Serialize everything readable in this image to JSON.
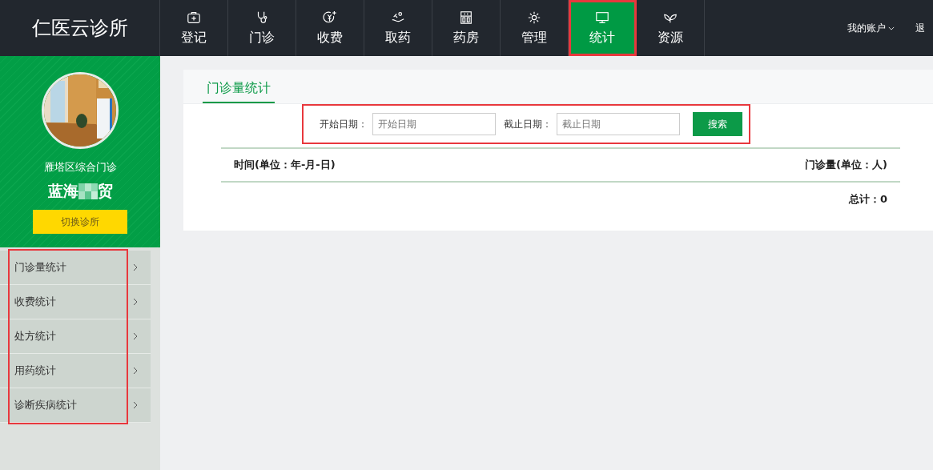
{
  "brand": "仁医云诊所",
  "nav": [
    {
      "label": "登记",
      "selected": false
    },
    {
      "label": "门诊",
      "selected": false
    },
    {
      "label": "收费",
      "selected": false
    },
    {
      "label": "取药",
      "selected": false
    },
    {
      "label": "药房",
      "selected": false
    },
    {
      "label": "管理",
      "selected": false
    },
    {
      "label": "统计",
      "selected": true
    },
    {
      "label": "资源",
      "selected": false
    }
  ],
  "account": {
    "label": "我的账户",
    "logout": "退"
  },
  "clinic": {
    "name": "雁塔区综合门诊",
    "user_start": "蓝海",
    "user_end": "贸",
    "switch_button": "切换诊所"
  },
  "sidebar": {
    "items": [
      {
        "label": "门诊量统计",
        "selected": false
      },
      {
        "label": "收费统计",
        "selected": false
      },
      {
        "label": "处方统计",
        "selected": false
      },
      {
        "label": "用药统计",
        "selected": false
      },
      {
        "label": "诊断疾病统计",
        "selected": false
      }
    ]
  },
  "tabs": [
    {
      "label": "门诊量统计",
      "selected": true
    }
  ],
  "search": {
    "start_label": "开始日期：",
    "start_placeholder": "开始日期",
    "end_label": "截止日期：",
    "end_placeholder": "截止日期",
    "button": "搜索"
  },
  "table": {
    "columns": [
      "时间(单位：年-月-日)",
      "门诊量(单位：人)"
    ],
    "total": "总计：0"
  }
}
